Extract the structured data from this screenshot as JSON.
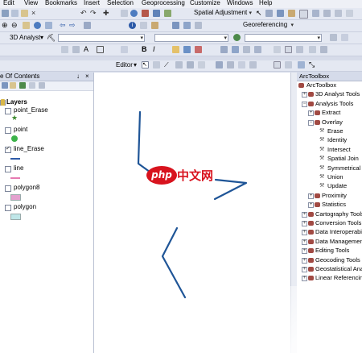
{
  "menu": [
    "Edit",
    "View",
    "Bookmarks",
    "Insert",
    "Selection",
    "Geoprocessing",
    "Customize",
    "Windows",
    "Help"
  ],
  "toolbar": {
    "spatial_adjustment": "Spatial Adjustment",
    "analyst_3d": "3D Analyst",
    "georeferencing": "Georeferencing",
    "editor": "Editor"
  },
  "toc": {
    "title": "e Of Contents",
    "pin": "↓",
    "close": "×",
    "root": "Layers",
    "layers": [
      {
        "name": "point_Erase",
        "checked": false,
        "symbol": "star",
        "color": "#3d8a2f"
      },
      {
        "name": "point",
        "checked": false,
        "symbol": "circle",
        "color": "#3cb34a"
      },
      {
        "name": "line_Erase",
        "checked": true,
        "symbol": "line",
        "color": "#2d5aa8"
      },
      {
        "name": "line",
        "checked": false,
        "symbol": "line",
        "color": "#e67ab2"
      },
      {
        "name": "polygon8",
        "checked": false,
        "symbol": "rect",
        "color": "#e4a1cf"
      },
      {
        "name": "polygon",
        "checked": false,
        "symbol": "rect",
        "color": "#bfe6e8"
      }
    ]
  },
  "toolbox": {
    "title": "ArcToolbox",
    "items": [
      {
        "label": "ArcToolbox",
        "level": 0,
        "kind": "root",
        "exp": ""
      },
      {
        "label": "3D Analyst Tools",
        "level": 1,
        "kind": "box",
        "exp": "+"
      },
      {
        "label": "Analysis Tools",
        "level": 1,
        "kind": "box",
        "exp": "−"
      },
      {
        "label": "Extract",
        "level": 2,
        "kind": "box",
        "exp": "+"
      },
      {
        "label": "Overlay",
        "level": 2,
        "kind": "box",
        "exp": "−"
      },
      {
        "label": "Erase",
        "level": 3,
        "kind": "tool",
        "exp": ""
      },
      {
        "label": "Identity",
        "level": 3,
        "kind": "tool",
        "exp": ""
      },
      {
        "label": "Intersect",
        "level": 3,
        "kind": "tool",
        "exp": ""
      },
      {
        "label": "Spatial Join",
        "level": 3,
        "kind": "tool",
        "exp": ""
      },
      {
        "label": "Symmetrical Difference",
        "level": 3,
        "kind": "tool",
        "exp": ""
      },
      {
        "label": "Union",
        "level": 3,
        "kind": "tool",
        "exp": ""
      },
      {
        "label": "Update",
        "level": 3,
        "kind": "tool",
        "exp": ""
      },
      {
        "label": "Proximity",
        "level": 2,
        "kind": "box",
        "exp": "+"
      },
      {
        "label": "Statistics",
        "level": 2,
        "kind": "box",
        "exp": "+"
      },
      {
        "label": "Cartography Tools",
        "level": 1,
        "kind": "box",
        "exp": "+"
      },
      {
        "label": "Conversion Tools",
        "level": 1,
        "kind": "box",
        "exp": "+"
      },
      {
        "label": "Data Interoperability Tools",
        "level": 1,
        "kind": "box",
        "exp": "+"
      },
      {
        "label": "Data Management Tools",
        "level": 1,
        "kind": "box",
        "exp": "+"
      },
      {
        "label": "Editing Tools",
        "level": 1,
        "kind": "box",
        "exp": "+"
      },
      {
        "label": "Geocoding Tools",
        "level": 1,
        "kind": "box",
        "exp": "+"
      },
      {
        "label": "Geostatistical Analyst Tools",
        "level": 1,
        "kind": "box",
        "exp": "+"
      },
      {
        "label": "Linear Referencing Tools",
        "level": 1,
        "kind": "box",
        "exp": "+"
      }
    ]
  },
  "watermark": {
    "logo": "php",
    "text": "中文网"
  },
  "colors": {
    "line_feature": "#1f5597",
    "accent": "#2d5aa8"
  }
}
